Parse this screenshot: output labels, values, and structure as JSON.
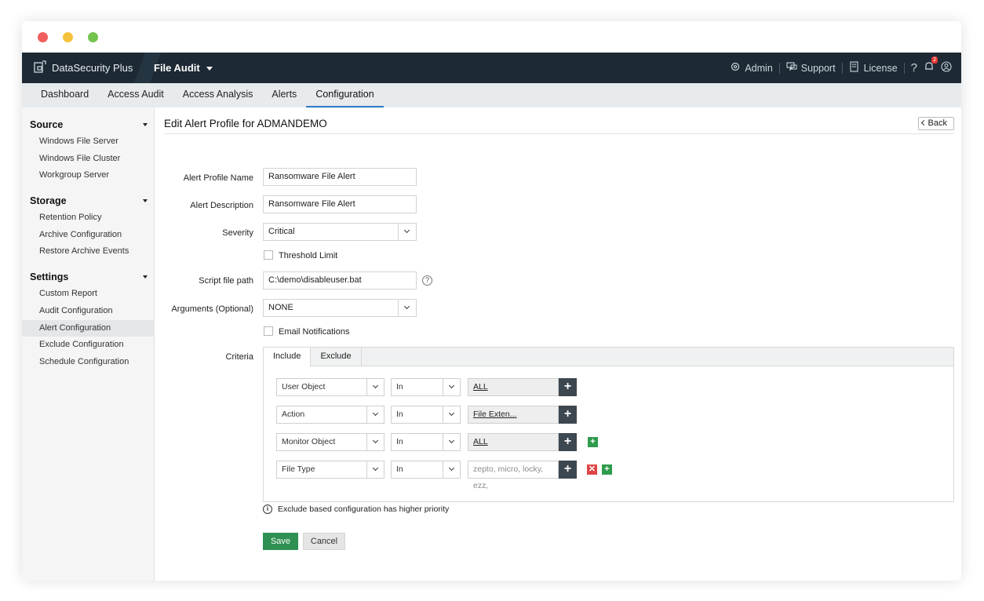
{
  "header": {
    "brand": "DataSecurity Plus",
    "module": "File Audit",
    "admin": "Admin",
    "support": "Support",
    "license": "License",
    "help": "?",
    "notif_count": "2"
  },
  "nav": {
    "tabs": [
      "Dashboard",
      "Access Audit",
      "Access Analysis",
      "Alerts",
      "Configuration"
    ],
    "active": "Configuration"
  },
  "sidebar": {
    "sections": [
      {
        "title": "Source",
        "items": [
          "Windows File Server",
          "Windows File Cluster",
          "Workgroup Server"
        ]
      },
      {
        "title": "Storage",
        "items": [
          "Retention Policy",
          "Archive Configuration",
          "Restore Archive Events"
        ]
      },
      {
        "title": "Settings",
        "items": [
          "Custom Report",
          "Audit Configuration",
          "Alert Configuration",
          "Exclude Configuration",
          "Schedule Configuration"
        ]
      }
    ],
    "active_item": "Alert Configuration"
  },
  "page": {
    "title": "Edit Alert Profile for ADMANDEMO",
    "back_label": "Back"
  },
  "form": {
    "profile_name_label": "Alert Profile Name",
    "profile_name_value": "Ransomware File Alert",
    "description_label": "Alert Description",
    "description_value": "Ransomware File Alert",
    "severity_label": "Severity",
    "severity_value": "Critical",
    "threshold_label": "Threshold Limit",
    "script_label": "Script file path",
    "script_value": "C:\\demo\\disableuser.bat",
    "arguments_label": "Arguments (Optional)",
    "arguments_value": "NONE",
    "email_label": "Email Notifications",
    "criteria_label": "Criteria"
  },
  "criteria": {
    "tabs": [
      "Include",
      "Exclude"
    ],
    "active_tab": "Include",
    "rows": [
      {
        "field": "User Object",
        "op": "In",
        "value": "ALL"
      },
      {
        "field": "Action",
        "op": "In",
        "value": "File Exten..."
      },
      {
        "field": "Monitor Object",
        "op": "In",
        "value": "ALL"
      },
      {
        "field": "File Type",
        "op": "In",
        "value": "zepto, micro, locky, ezz,"
      }
    ],
    "note": "Exclude based configuration has higher priority"
  },
  "actions": {
    "save": "Save",
    "cancel": "Cancel"
  },
  "colors": {
    "topbar": "#1d2a35",
    "accent": "#2b79c2",
    "save": "#2e9052"
  }
}
